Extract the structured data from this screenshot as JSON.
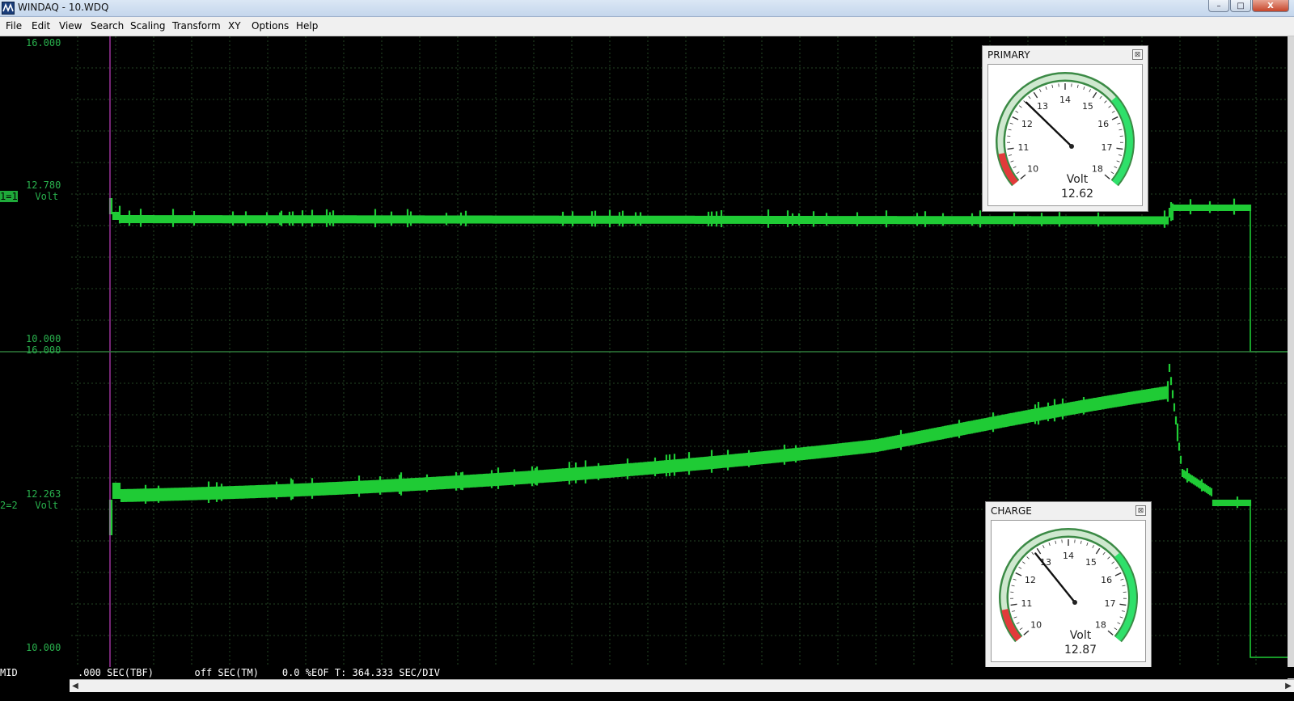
{
  "window": {
    "title": "WINDAQ - 10.WDQ",
    "minimize_glyph": "–",
    "maximize_glyph": "□",
    "close_glyph": "X"
  },
  "menu": [
    "File",
    "Edit",
    "View",
    "Search",
    "Scaling",
    "Transform",
    "XY",
    "Options",
    "Help"
  ],
  "channels": [
    {
      "id": "1=1",
      "unit": "Volt",
      "top_label": "16.000",
      "mid_label": "12.780",
      "bottom_label": "10.000"
    },
    {
      "id": "2=2",
      "unit": "Volt",
      "top_label": "16.000",
      "mid_label": "12.263",
      "bottom_label": "10.000"
    }
  ],
  "meters": [
    {
      "title": "PRIMARY",
      "unit": "Volt",
      "value_text": "12.62",
      "value": 12.62,
      "ticks": [
        "10",
        "11",
        "12",
        "13",
        "14",
        "15",
        "16",
        "17",
        "18"
      ]
    },
    {
      "title": "CHARGE",
      "unit": "Volt",
      "value_text": "12.87",
      "value": 12.87,
      "ticks": [
        "10",
        "11",
        "12",
        "13",
        "14",
        "15",
        "16",
        "17",
        "18"
      ]
    }
  ],
  "status": {
    "mode": "MID",
    "text": ".000 SEC(TBF)       off SEC(TM)    0.0 %EOF T: 364.333 SEC/DIV"
  },
  "colors": {
    "trace": "#1fcb35",
    "grid": "#2f5a2f",
    "cursor": "#c040c0",
    "axis_label": "#29b04d"
  }
}
